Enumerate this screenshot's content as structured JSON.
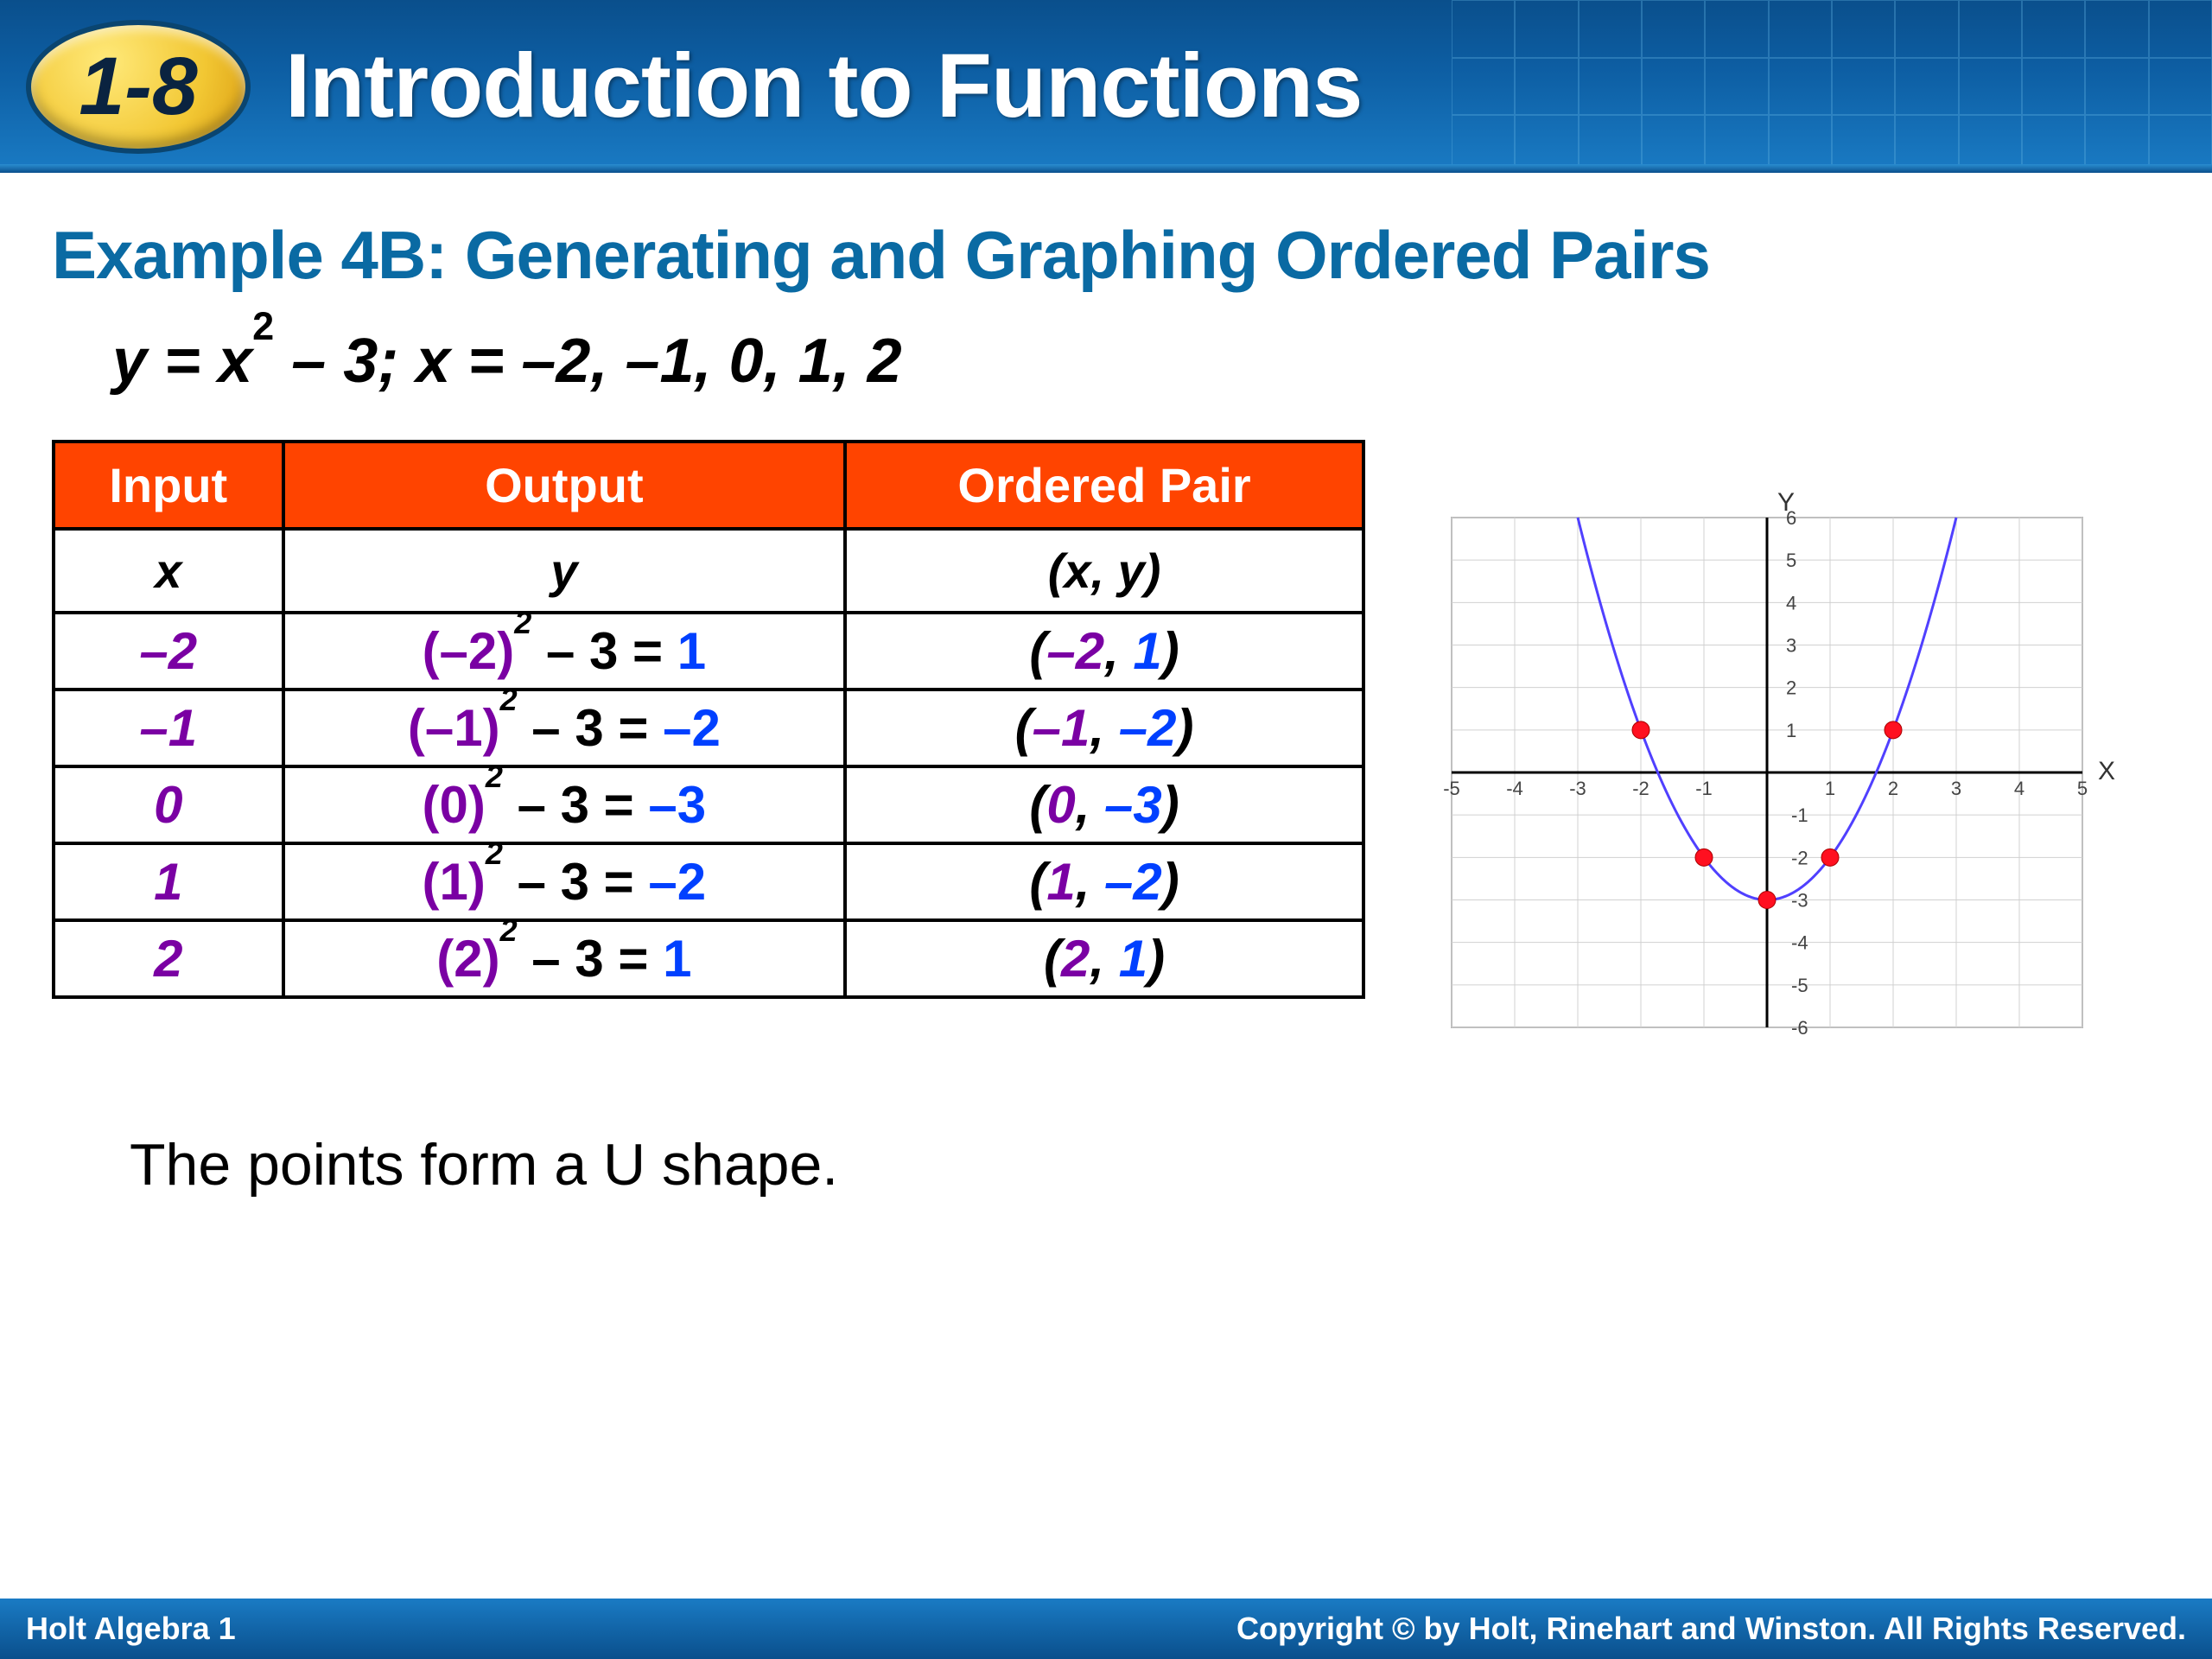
{
  "banner": {
    "badge": "1-8",
    "title": "Introduction to Functions"
  },
  "example_title": "Example 4B: Generating and Graphing Ordered Pairs",
  "equation_html": "y = x<sup>2</sup> – 3; x = –2, –1, 0, 1, 2",
  "table": {
    "headers": [
      "Input",
      "Output",
      "Ordered Pair"
    ],
    "subheads": [
      "x",
      "y",
      "(x, y)"
    ],
    "rows": [
      {
        "x": "–2",
        "xcol": "#7a00a3",
        "out_pre": "(–2)",
        "out_exp": "2",
        "out_mid": " – 3 = ",
        "res": "1",
        "rescol": "#0040ff",
        "pair_x": "–2",
        "pair_y": "1",
        "pxcol": "#7a00a3",
        "pycol": "#0040ff"
      },
      {
        "x": "–1",
        "xcol": "#7a00a3",
        "out_pre": "(–1)",
        "out_exp": "2",
        "out_mid": " – 3 = ",
        "res": "–2",
        "rescol": "#0040ff",
        "pair_x": "–1",
        "pair_y": "–2",
        "pxcol": "#7a00a3",
        "pycol": "#0040ff"
      },
      {
        "x": "0",
        "xcol": "#7a00a3",
        "out_pre": "(0)",
        "out_exp": "2",
        "out_mid": " – 3 = ",
        "res": "–3",
        "rescol": "#0040ff",
        "pair_x": "0",
        "pair_y": "–3",
        "pxcol": "#7a00a3",
        "pycol": "#0040ff"
      },
      {
        "x": "1",
        "xcol": "#7a00a3",
        "out_pre": "(1)",
        "out_exp": "2",
        "out_mid": " – 3 = ",
        "res": "–2",
        "rescol": "#0040ff",
        "pair_x": "1",
        "pair_y": "–2",
        "pxcol": "#7a00a3",
        "pycol": "#0040ff"
      },
      {
        "x": "2",
        "xcol": "#7a00a3",
        "out_pre": "(2)",
        "out_exp": "2",
        "out_mid": " – 3 = ",
        "res": "1",
        "rescol": "#0040ff",
        "pair_x": "2",
        "pair_y": "1",
        "pxcol": "#7a00a3",
        "pycol": "#0040ff"
      }
    ]
  },
  "note": "The points form a U shape.",
  "footer_left": "Holt Algebra 1",
  "footer_right": "Copyright © by Holt, Rinehart and Winston. All Rights Reserved.",
  "chart_data": {
    "type": "scatter",
    "title": "",
    "xlabel": "X",
    "ylabel": "Y",
    "xlim": [
      -5,
      5
    ],
    "ylim": [
      -6,
      6
    ],
    "points": [
      [
        -2,
        1
      ],
      [
        -1,
        -2
      ],
      [
        0,
        -3
      ],
      [
        1,
        -2
      ],
      [
        2,
        1
      ]
    ],
    "curve": "y = x^2 - 3",
    "xticks": [
      -5,
      -4,
      -3,
      -2,
      -1,
      1,
      2,
      3,
      4,
      5
    ],
    "yticks": [
      -6,
      -5,
      -4,
      -3,
      -2,
      -1,
      1,
      2,
      3,
      4,
      5,
      6
    ]
  }
}
